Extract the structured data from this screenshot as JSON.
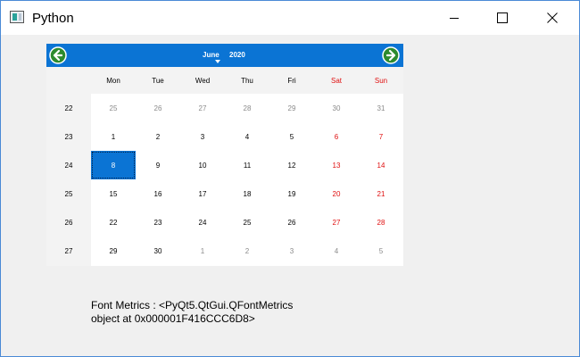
{
  "window": {
    "title": "Python"
  },
  "calendar": {
    "month": "June",
    "year": "2020",
    "weekdays": [
      "Mon",
      "Tue",
      "Wed",
      "Thu",
      "Fri",
      "Sat",
      "Sun"
    ],
    "weeks": [
      "22",
      "23",
      "24",
      "25",
      "26",
      "27"
    ],
    "days": [
      [
        "25",
        "26",
        "27",
        "28",
        "29",
        "30",
        "31"
      ],
      [
        "1",
        "2",
        "3",
        "4",
        "5",
        "6",
        "7"
      ],
      [
        "8",
        "9",
        "10",
        "11",
        "12",
        "13",
        "14"
      ],
      [
        "15",
        "16",
        "17",
        "18",
        "19",
        "20",
        "21"
      ],
      [
        "22",
        "23",
        "24",
        "25",
        "26",
        "27",
        "28"
      ],
      [
        "29",
        "30",
        "1",
        "2",
        "3",
        "4",
        "5"
      ]
    ],
    "selected_day": "8"
  },
  "info_text": "Font Metrics : <PyQt5.QtGui.QFontMetrics object at 0x000001F416CCC6D8>",
  "colors": {
    "accent": "#0b74d4",
    "weekend": "#e01010",
    "nav_icon": "#2e8b2e"
  },
  "icons": {
    "prev": "arrow-left-circle-icon",
    "next": "arrow-right-circle-icon",
    "app": "python-window-icon"
  }
}
